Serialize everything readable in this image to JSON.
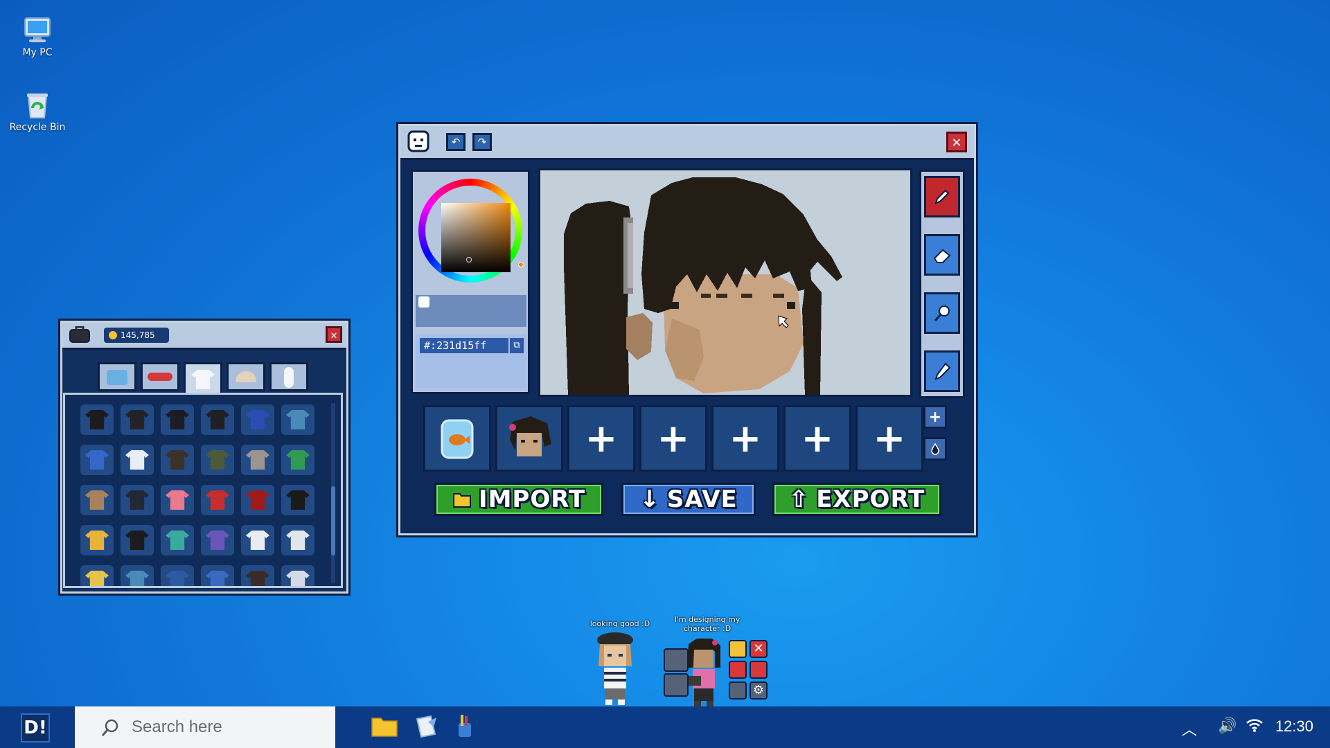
{
  "desktop": {
    "icons": [
      {
        "label": "My PC",
        "icon": "monitor-icon"
      },
      {
        "label": "Recycle Bin",
        "icon": "recycle-bin-icon"
      }
    ]
  },
  "editor": {
    "title_icons": [
      "avatar-face-icon",
      "undo-icon",
      "redo-icon"
    ],
    "color": {
      "hex": "231d15ff",
      "hex_prefix": "#:",
      "current": "#231d15",
      "wheel_hue": "#f08a10"
    },
    "tools": [
      {
        "name": "pencil",
        "icon": "pencil-icon",
        "active": true
      },
      {
        "name": "eraser",
        "icon": "eraser-icon",
        "active": false
      },
      {
        "name": "fill",
        "icon": "paint-bucket-icon",
        "active": false
      },
      {
        "name": "eyedropper",
        "icon": "eyedropper-icon",
        "active": false
      }
    ],
    "slots": [
      {
        "type": "goldfish-jar",
        "icon": "goldfish-icon"
      },
      {
        "type": "avatar-head",
        "icon": "avatar-head-icon"
      },
      {
        "type": "empty",
        "label": "+"
      },
      {
        "type": "empty",
        "label": "+"
      },
      {
        "type": "empty",
        "label": "+"
      },
      {
        "type": "empty",
        "label": "+"
      },
      {
        "type": "empty",
        "label": "+"
      }
    ],
    "side_buttons": [
      {
        "label": "+",
        "icon": "plus-icon"
      },
      {
        "label": "",
        "icon": "drop-icon"
      }
    ],
    "buttons": {
      "import": "IMPORT",
      "save": "SAVE",
      "export": "EXPORT"
    },
    "colors": {
      "import": "#2f9f2c",
      "save": "#2f68c6",
      "export": "#2f9f2c",
      "active_tool": "#c0282e"
    }
  },
  "inventory": {
    "coins": "145,785",
    "tabs": [
      "furniture-icon",
      "plane-icon",
      "shirt-icon",
      "hat-icon",
      "body-icon"
    ],
    "active_tab": 2,
    "items": [
      [
        "#1b1b1f",
        "#232327",
        "#1c1c22",
        "#202024",
        "#2b4db3",
        "#4a8ab8"
      ],
      [
        "#3367c8",
        "#e8eef5",
        "#3a3228",
        "#4d5a3a",
        "#9a968f",
        "#2f9a52"
      ],
      [
        "#a8825a",
        "#232836",
        "#e87a8c",
        "#c72d2d",
        "#a01b1b",
        "#1a1a1a"
      ],
      [
        "#e6b43a",
        "#1c1c20",
        "#3aaa9c",
        "#6a55b8",
        "#e9edf2",
        "#e1e6ee"
      ],
      [
        "#e6c34a",
        "#4a8ab8",
        "#2c5aa0",
        "#3a6ac0",
        "#3a2a2a",
        "#d5dbe6"
      ]
    ]
  },
  "characters": [
    {
      "speech": "looking good :D"
    },
    {
      "speech": "I'm designing my character :D"
    }
  ],
  "taskbar": {
    "start_label": "D!",
    "search_placeholder": "Search here",
    "apps": [
      "folder-icon",
      "notes-icon",
      "paint-cup-icon"
    ],
    "clock": "12:30"
  }
}
